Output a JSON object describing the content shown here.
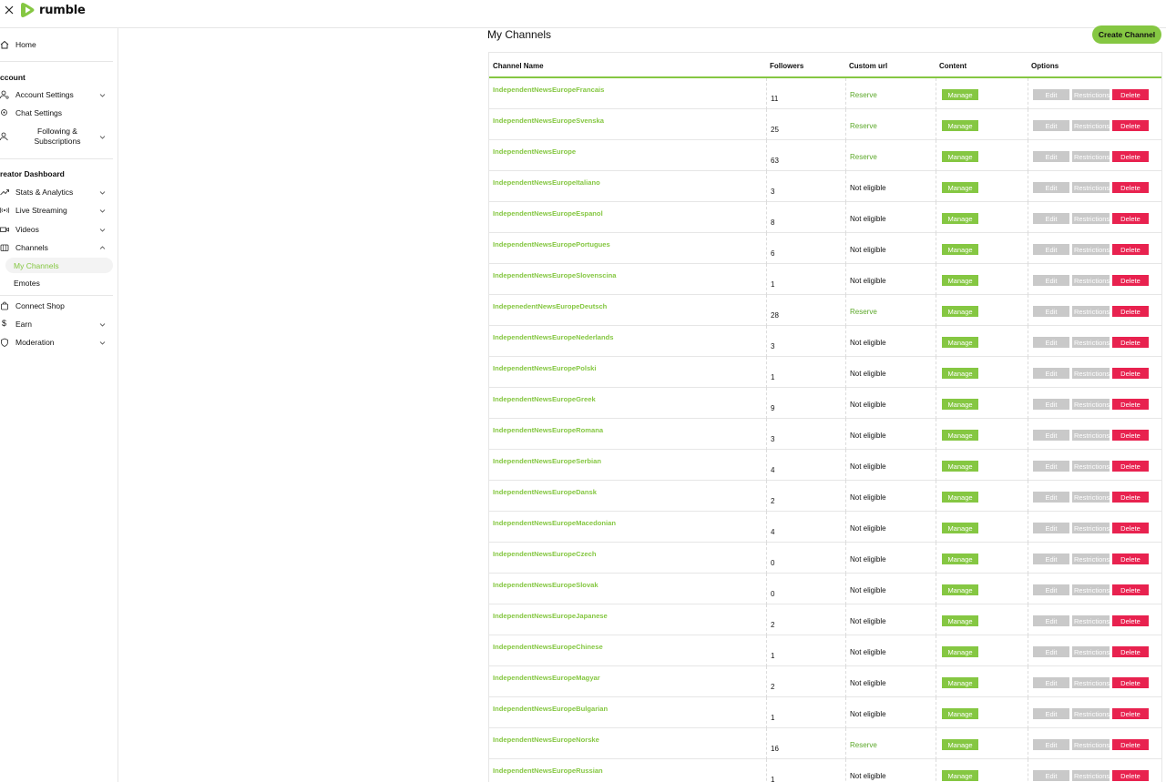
{
  "header": {
    "logo_text": "rumble"
  },
  "sidebar": {
    "home": "Home",
    "account_title": "ccount",
    "account_settings": "Account Settings",
    "chat_settings": "Chat Settings",
    "following_line1": "Following &",
    "following_line2": "Subscriptions",
    "creator_title": "reator Dashboard",
    "stats": "Stats & Analytics",
    "live": "Live Streaming",
    "videos": "Videos",
    "channels": "Channels",
    "my_channels": "My Channels",
    "emotes": "Emotes",
    "connect_shop": "Connect Shop",
    "earn": "Earn",
    "moderation": "Moderation"
  },
  "main": {
    "title": "My Channels",
    "create_button": "Create Channel"
  },
  "table": {
    "headers": [
      "Channel Name",
      "Followers",
      "Custom url",
      "Content",
      "Options"
    ],
    "buttons": {
      "manage": "Manage",
      "edit": "Edit",
      "restrictions": "Restrictions",
      "delete": "Delete"
    },
    "rows": [
      {
        "name": "IndependentNewsEuropeFrancais",
        "followers": "11",
        "custom_url": "Reserve"
      },
      {
        "name": "IndependentNewsEuropeSvenska",
        "followers": "25",
        "custom_url": "Reserve"
      },
      {
        "name": "IndependentNewsEurope",
        "followers": "63",
        "custom_url": "Reserve"
      },
      {
        "name": "IndependentNewsEuropeItaliano",
        "followers": "3",
        "custom_url": "Not eligible"
      },
      {
        "name": "IndependentNewsEuropeEspanol",
        "followers": "8",
        "custom_url": "Not eligible"
      },
      {
        "name": "IndependentNewsEuropePortugues",
        "followers": "6",
        "custom_url": "Not eligible"
      },
      {
        "name": "IndependentNewsEuropeSlovenscina",
        "followers": "1",
        "custom_url": "Not eligible"
      },
      {
        "name": "IndepenedentNewsEuropeDeutsch",
        "followers": "28",
        "custom_url": "Reserve"
      },
      {
        "name": "IndependentNewsEuropeNederlands",
        "followers": "3",
        "custom_url": "Not eligible"
      },
      {
        "name": "IndependentNewsEuropePolski",
        "followers": "1",
        "custom_url": "Not eligible"
      },
      {
        "name": "IndependentNewsEuropeGreek",
        "followers": "9",
        "custom_url": "Not eligible"
      },
      {
        "name": "IndependentNewsEuropeRomana",
        "followers": "3",
        "custom_url": "Not eligible"
      },
      {
        "name": "IndependentNewsEuropeSerbian",
        "followers": "4",
        "custom_url": "Not eligible"
      },
      {
        "name": "IndependentNewsEuropeDansk",
        "followers": "2",
        "custom_url": "Not eligible"
      },
      {
        "name": "IndependentNewsEuropeMacedonian",
        "followers": "4",
        "custom_url": "Not eligible"
      },
      {
        "name": "IndependentNewsEuropeCzech",
        "followers": "0",
        "custom_url": "Not eligible"
      },
      {
        "name": "IndependentNewsEuropeSlovak",
        "followers": "0",
        "custom_url": "Not eligible"
      },
      {
        "name": "IndependentNewsEuropeJapanese",
        "followers": "2",
        "custom_url": "Not eligible"
      },
      {
        "name": "IndependentNewsEuropeChinese",
        "followers": "1",
        "custom_url": "Not eligible"
      },
      {
        "name": "IndependentNewsEuropeMagyar",
        "followers": "2",
        "custom_url": "Not eligible"
      },
      {
        "name": "IndependentNewsEuropeBulgarian",
        "followers": "1",
        "custom_url": "Not eligible"
      },
      {
        "name": "IndependentNewsEuropeNorske",
        "followers": "16",
        "custom_url": "Reserve"
      },
      {
        "name": "IndependentNewsEuropeRussian",
        "followers": "1",
        "custom_url": "Not eligible"
      }
    ]
  },
  "colors": {
    "accent": "#85c742",
    "danger": "#e8224f",
    "disabled": "#c9c9c9"
  }
}
